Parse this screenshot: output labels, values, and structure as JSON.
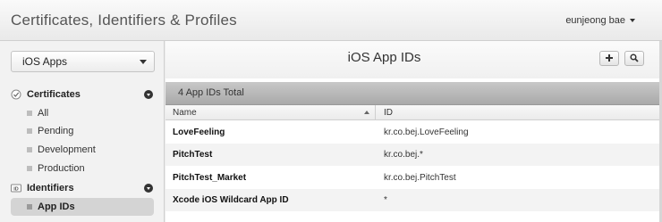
{
  "header": {
    "title": "Certificates, Identifiers & Profiles",
    "user": "eunjeong bae"
  },
  "sidebar": {
    "platform": "iOS Apps",
    "sections": [
      {
        "label": "Certificates",
        "icon": "certificate-icon",
        "items": [
          "All",
          "Pending",
          "Development",
          "Production"
        ]
      },
      {
        "label": "Identifiers",
        "icon": "id-icon",
        "items": [
          "App IDs"
        ]
      }
    ],
    "active_item": "App IDs"
  },
  "main": {
    "title": "iOS App IDs",
    "total": "4 App IDs Total",
    "columns": {
      "name": "Name",
      "id": "ID"
    },
    "rows": [
      {
        "name": "LoveFeeling",
        "id": "kr.co.bej.LoveFeeling"
      },
      {
        "name": "PitchTest",
        "id": "kr.co.bej.*"
      },
      {
        "name": "PitchTest_Market",
        "id": "kr.co.bej.PitchTest"
      },
      {
        "name": "Xcode iOS Wildcard App ID",
        "id": "*"
      }
    ],
    "actions": {
      "add_icon": "plus-icon",
      "search_icon": "search-icon"
    }
  }
}
